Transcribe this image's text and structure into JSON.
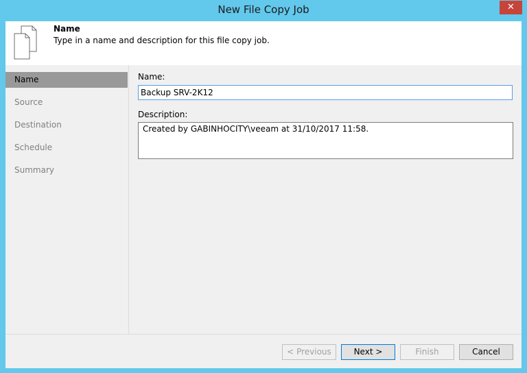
{
  "window": {
    "title": "New File Copy Job",
    "close_glyph": "✕"
  },
  "header": {
    "title": "Name",
    "description": "Type in a name and description for this file copy job.",
    "icon": "document-copy-icon"
  },
  "sidebar": {
    "steps": [
      {
        "label": "Name",
        "active": true
      },
      {
        "label": "Source",
        "active": false
      },
      {
        "label": "Destination",
        "active": false
      },
      {
        "label": "Schedule",
        "active": false
      },
      {
        "label": "Summary",
        "active": false
      }
    ]
  },
  "form": {
    "name_label": "Name:",
    "name_value": "Backup SRV-2K12",
    "description_label": "Description:",
    "description_value": "Created by GABINHOCITY\\veeam at 31/10/2017 11:58."
  },
  "footer": {
    "previous_label": "< Previous",
    "next_label": "Next >",
    "finish_label": "Finish",
    "cancel_label": "Cancel"
  },
  "colors": {
    "titlebar": "#62c8ec",
    "close": "#c7443b",
    "active_step": "#999999",
    "focus_border": "#569de5"
  }
}
